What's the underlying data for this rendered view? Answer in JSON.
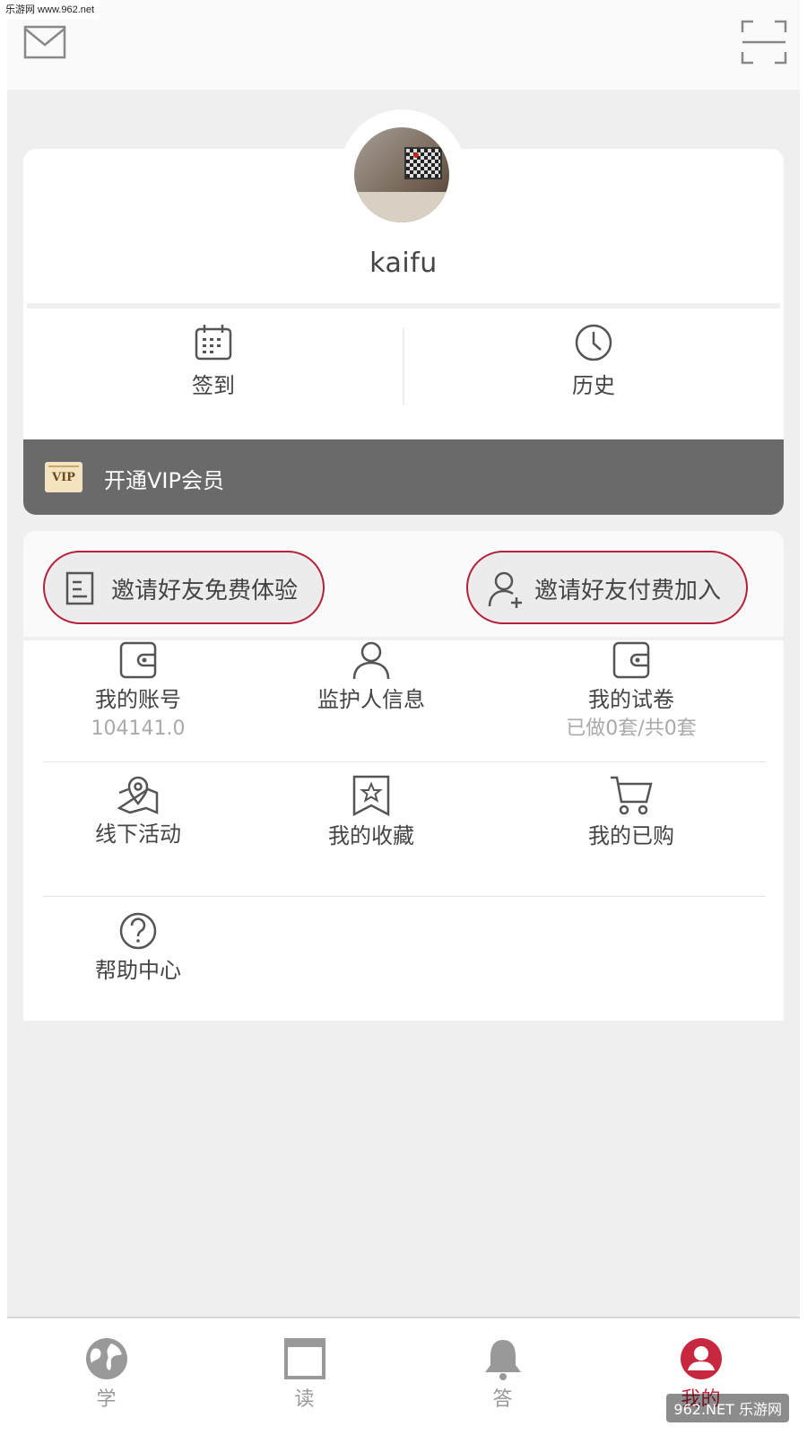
{
  "watermark_top": "乐游网 www.962.net",
  "user": {
    "name": "kaifu"
  },
  "quick_actions": [
    {
      "label": "签到",
      "icon": "calendar-icon"
    },
    {
      "label": "历史",
      "icon": "clock-icon"
    }
  ],
  "vip": {
    "badge": "VIP",
    "label": "开通VIP会员",
    "bar_color": "#6a6a6a"
  },
  "invite": {
    "free": {
      "label": "邀请好友免费体验",
      "icon": "document-icon"
    },
    "paid": {
      "label": "邀请好友付费加入",
      "icon": "add-user-icon"
    },
    "border_color": "#b3213a"
  },
  "menu": {
    "items": [
      {
        "label": "我的账号",
        "sub": "104141.0",
        "icon": "wallet-icon"
      },
      {
        "label": "监护人信息",
        "sub": "",
        "icon": "person-icon"
      },
      {
        "label": "我的试卷",
        "sub": "已做0套/共0套",
        "icon": "wallet-icon"
      },
      {
        "label": "线下活动",
        "sub": "",
        "icon": "map-pin-icon"
      },
      {
        "label": "我的收藏",
        "sub": "",
        "icon": "bookmark-star-icon"
      },
      {
        "label": "我的已购",
        "sub": "",
        "icon": "cart-icon"
      },
      {
        "label": "帮助中心",
        "sub": "",
        "icon": "question-icon"
      }
    ]
  },
  "tabs": [
    {
      "label": "学",
      "icon": "globe-icon",
      "active": false
    },
    {
      "label": "读",
      "icon": "window-icon",
      "active": false
    },
    {
      "label": "答",
      "icon": "bell-icon",
      "active": false
    },
    {
      "label": "我的",
      "icon": "user-circle-icon",
      "active": true
    }
  ],
  "accent_color": "#c8283f",
  "watermark_bottom": "962.NET 乐游网"
}
